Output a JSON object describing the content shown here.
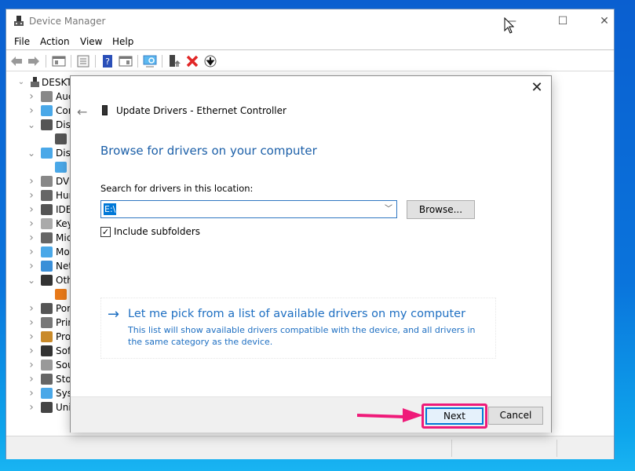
{
  "window": {
    "title": "Device Manager",
    "controls": {
      "minimize": "—",
      "maximize": "☐",
      "close": "✕"
    }
  },
  "menu": [
    "File",
    "Action",
    "View",
    "Help"
  ],
  "toolbar": {
    "buttons": [
      "back-icon",
      "forward-icon",
      "show-hide-console-tree-icon",
      "properties-icon",
      "help-icon",
      "show-hide-action-pane-icon",
      "scan-hardware-icon",
      "update-driver-icon",
      "uninstall-device-icon",
      "disable-device-icon"
    ]
  },
  "tree": {
    "root": "DESKTO",
    "items": [
      {
        "label": "Auc",
        "icon": "audio-icon",
        "expanded": false
      },
      {
        "label": "Cor",
        "icon": "computer-icon",
        "expanded": false
      },
      {
        "label": "Disl",
        "icon": "disk-icon",
        "expanded": true
      },
      {
        "label": "",
        "icon": "disk-drive-icon",
        "child": true
      },
      {
        "label": "Disp",
        "icon": "display-icon",
        "expanded": true
      },
      {
        "label": "",
        "icon": "display-adapter-icon",
        "child": true
      },
      {
        "label": "DVI",
        "icon": "dvd-icon",
        "expanded": false
      },
      {
        "label": "Hur",
        "icon": "hid-icon",
        "expanded": false
      },
      {
        "label": "IDE",
        "icon": "ide-icon",
        "expanded": false
      },
      {
        "label": "Key",
        "icon": "keyboard-icon",
        "expanded": false
      },
      {
        "label": "Mic",
        "icon": "mouse-icon",
        "expanded": false
      },
      {
        "label": "Mo",
        "icon": "monitor-icon",
        "expanded": false
      },
      {
        "label": "Net",
        "icon": "network-icon",
        "expanded": false
      },
      {
        "label": "Oth",
        "icon": "other-devices-icon",
        "expanded": true
      },
      {
        "label": "",
        "icon": "unknown-device-warning-icon",
        "child": true
      },
      {
        "label": "Por",
        "icon": "ports-icon",
        "expanded": false
      },
      {
        "label": "Prir",
        "icon": "print-queue-icon",
        "expanded": false
      },
      {
        "label": "Pro",
        "icon": "processor-icon",
        "expanded": false
      },
      {
        "label": "Sof",
        "icon": "software-device-icon",
        "expanded": false
      },
      {
        "label": "Sou",
        "icon": "sound-icon",
        "expanded": false
      },
      {
        "label": "Sto",
        "icon": "storage-icon",
        "expanded": false
      },
      {
        "label": "Sys",
        "icon": "system-devices-icon",
        "expanded": false
      },
      {
        "label": "Uni",
        "icon": "usb-icon",
        "expanded": false
      }
    ]
  },
  "dialog": {
    "title": "Update Drivers - Ethernet Controller",
    "heading": "Browse for drivers on your computer",
    "search_label": "Search for drivers in this location:",
    "path_value": "E:\\",
    "browse_label": "Browse...",
    "include_subfolders_label": "Include subfolders",
    "include_subfolders_checked": true,
    "pick_title": "Let me pick from a list of available drivers on my computer",
    "pick_desc": "This list will show available drivers compatible with the device, and all drivers in the same category as the device.",
    "next_label": "Next",
    "cancel_label": "Cancel",
    "close_glyph": "✕",
    "back_glyph": "←",
    "pick_arrow_glyph": "→"
  },
  "colors": {
    "link_blue": "#1e6fc2",
    "highlight_pink": "#ef1a79",
    "focus_blue": "#0078d7"
  }
}
